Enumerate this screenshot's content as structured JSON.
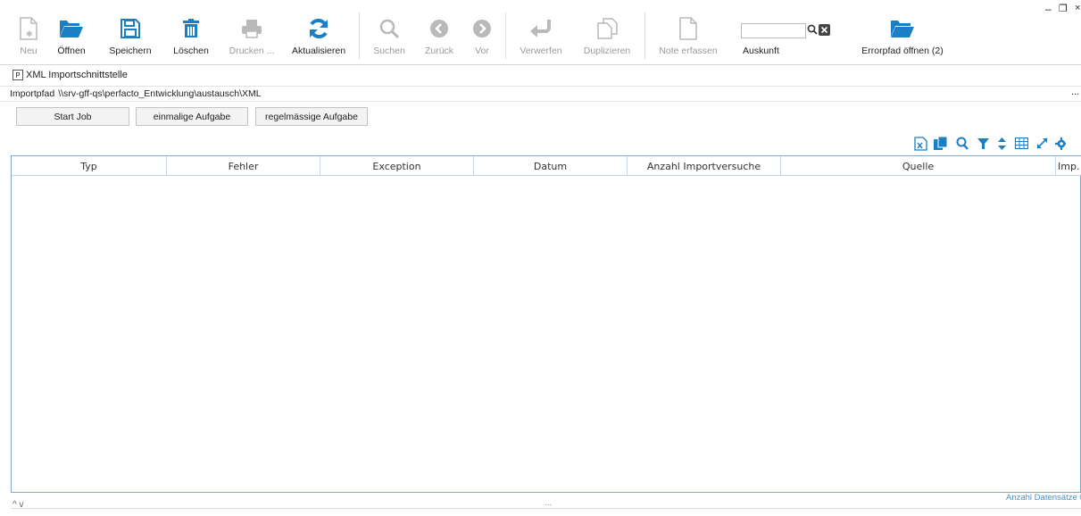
{
  "toolbar": {
    "items": [
      {
        "label": "Neu",
        "icon": "new-document-icon",
        "enabled": false
      },
      {
        "label": "Öffnen",
        "icon": "folder-open-icon",
        "enabled": true
      },
      {
        "label": "Speichern",
        "icon": "save-icon",
        "enabled": true
      },
      {
        "label": "Löschen",
        "icon": "trash-icon",
        "enabled": true
      },
      {
        "label": "Drucken ...",
        "icon": "printer-icon",
        "enabled": false
      },
      {
        "label": "Aktualisieren",
        "icon": "refresh-icon",
        "enabled": true
      },
      {
        "label": "Suchen",
        "icon": "search-icon",
        "enabled": false
      },
      {
        "label": "Zurück",
        "icon": "back-icon",
        "enabled": false
      },
      {
        "label": "Vor",
        "icon": "forward-icon",
        "enabled": false
      },
      {
        "label": "Verwerfen",
        "icon": "undo-icon",
        "enabled": false
      },
      {
        "label": "Duplizieren",
        "icon": "duplicate-icon",
        "enabled": false
      },
      {
        "label": "Note erfassen",
        "icon": "note-icon",
        "enabled": false
      }
    ],
    "auskunft": {
      "label": "Auskunft",
      "value": ""
    },
    "errorpath": {
      "label": "Errorpfad öffnen (2)",
      "icon": "folder-open-icon"
    }
  },
  "window": {
    "title": "XML Importschnittstelle",
    "minimize": "–",
    "restore": "❐",
    "close": "×"
  },
  "path": {
    "label": "Importpfad",
    "value": "\\\\srv-gff-qs\\perfacto_Entwicklung\\austausch\\XML",
    "more": "..."
  },
  "jobs": {
    "start": "Start Job",
    "once": "einmalige Aufgabe",
    "recurring": "regelmässige Aufgabe"
  },
  "table": {
    "columns": [
      "Typ",
      "Fehler",
      "Exception",
      "Datum",
      "Anzahl Importversuche",
      "Quelle",
      "Imp."
    ],
    "rows": []
  },
  "footer": {
    "collapse": "^ v",
    "dots": "...",
    "count_label": "Anzahl Datensätze 0"
  },
  "colors": {
    "accent": "#1a7fc4",
    "disabled": "#b9b9b9",
    "table_border": "#7fa6cf"
  }
}
